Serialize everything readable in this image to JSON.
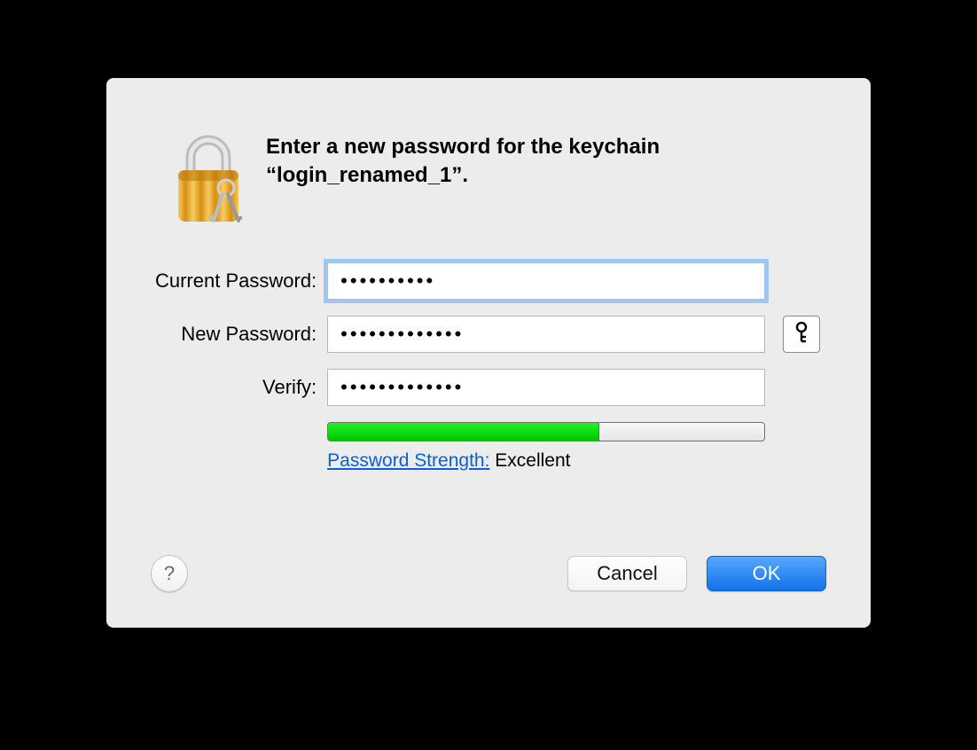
{
  "dialog": {
    "heading": "Enter a new password for the keychain “login_renamed_1”.",
    "labels": {
      "current": "Current Password:",
      "new": "New Password:",
      "verify": "Verify:"
    },
    "values": {
      "current": "••••••••••",
      "new": "•••••••••••••",
      "verify": "•••••••••••••"
    },
    "strength": {
      "link_label": "Password Strength:",
      "value_label": "Excellent",
      "percent": 62
    },
    "buttons": {
      "help": "?",
      "cancel": "Cancel",
      "ok": "OK"
    },
    "icons": {
      "lock": "lock-icon",
      "key": "key-icon"
    }
  }
}
